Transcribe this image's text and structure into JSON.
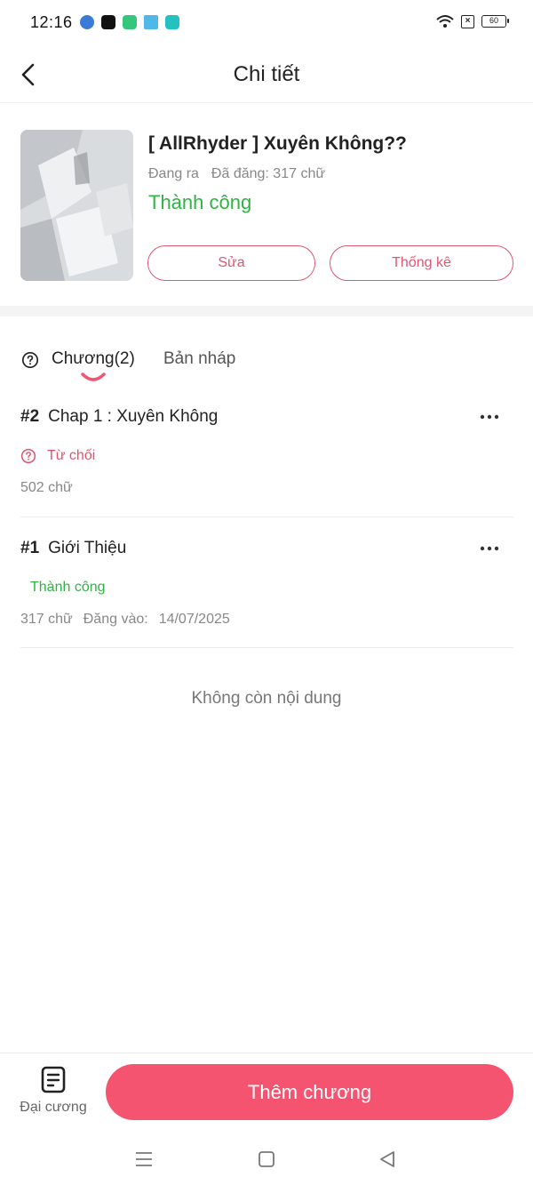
{
  "status_bar": {
    "time": "12:16",
    "battery": "60"
  },
  "header": {
    "title": "Chi tiết"
  },
  "book": {
    "title": "[ AllRhyder ] Xuyên Không??",
    "state": "Đang ra",
    "words": "Đã đăng: 317 chữ",
    "status": "Thành công",
    "edit_label": "Sửa",
    "stats_label": "Thống kê"
  },
  "tabs": {
    "chapters_label": "Chương(2)",
    "drafts_label": "Bản nháp"
  },
  "chapters": [
    {
      "number": "#2",
      "title": "Chap 1 : Xuyên Không",
      "status": "Từ chối",
      "words": "502 chữ"
    },
    {
      "number": "#1",
      "title": "Giới Thiệu",
      "status": "Thành công",
      "words": "317 chữ",
      "published_label": "Đăng vào:",
      "published_date": "14/07/2025"
    }
  ],
  "end_message": "Không còn nội dung",
  "bottom_bar": {
    "outline_label": "Đại cương",
    "add_chapter_label": "Thêm chương"
  },
  "colors": {
    "accent": "#f55471",
    "success": "#2fb344",
    "reject": "#e0566f"
  }
}
